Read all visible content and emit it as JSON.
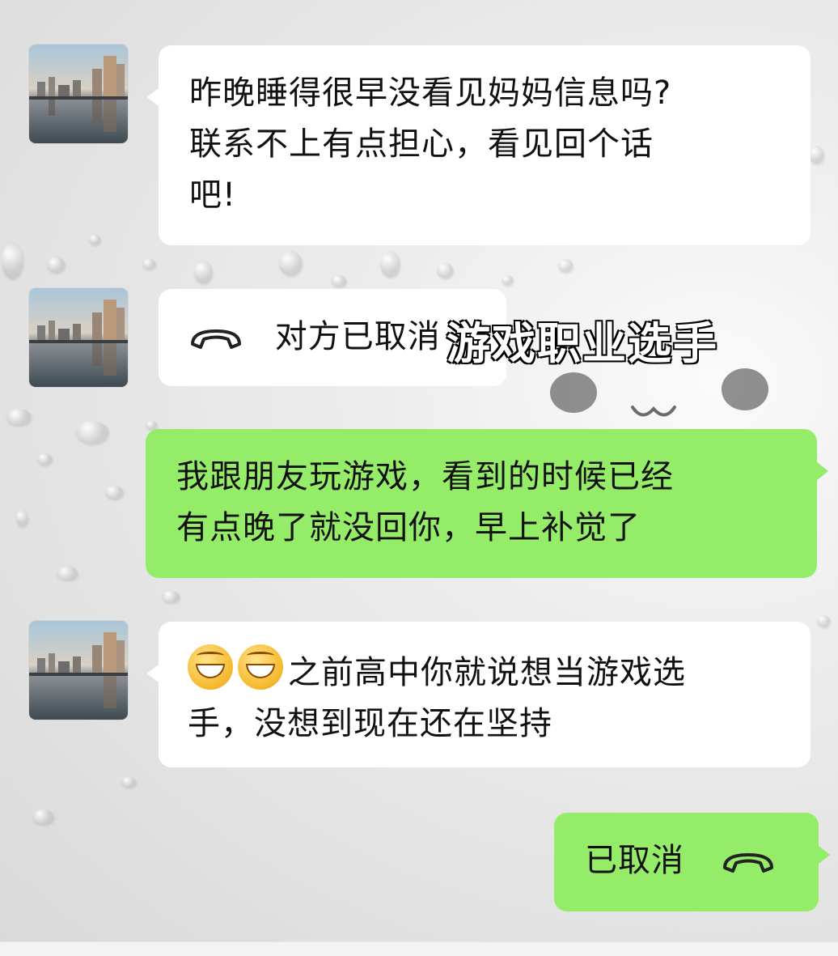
{
  "messages": [
    {
      "side": "left",
      "text_lines": [
        "昨晚睡得很早没看见妈妈信息吗?",
        "联系不上有点担心，看见回个话",
        "吧!"
      ]
    },
    {
      "side": "left",
      "call_text": "对方已取消"
    },
    {
      "side": "right",
      "text_lines": [
        "我跟朋友玩游戏，看到的时候已经",
        "有点晚了就没回你，早上补觉了"
      ]
    },
    {
      "side": "left",
      "emoji": "grinning-face-emoji",
      "text_lines": [
        "之前高中你就说想当游戏选",
        "手，没想到现在还在坚持"
      ]
    },
    {
      "side": "right",
      "call_text": "已取消"
    }
  ],
  "overlay_caption": "游戏职业选手",
  "colors": {
    "sent_bubble": "#95ec69",
    "received_bubble": "#ffffff",
    "text": "#111111"
  },
  "icons": [
    "phone-hangup-icon",
    "grinning-face-emoji"
  ]
}
